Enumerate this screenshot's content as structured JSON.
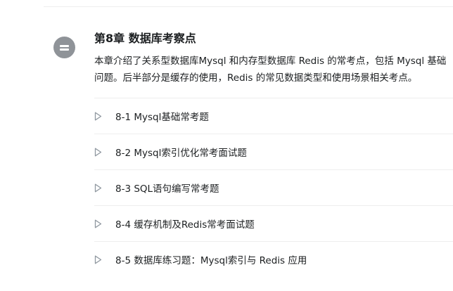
{
  "chapter": {
    "icon": "list-icon",
    "title": "第8章 数据库考察点",
    "description_lines": [
      "本章介绍了关系型数据库Mysql 和内存型数据库 Redis 的常考点，包括 Mysql 基础",
      "问题。后半部分是缓存的使用，Redis 的常见数据类型和使用场景相关考点。"
    ]
  },
  "lessons": [
    {
      "label": "8-1 Mysql基础常考题",
      "icon": "play-triangle-icon"
    },
    {
      "label": "8-2 Mysql索引优化常考面试题",
      "icon": "play-triangle-icon"
    },
    {
      "label": "8-3 SQL语句编写常考题",
      "icon": "play-triangle-icon"
    },
    {
      "label": "8-4 缓存机制及Redis常考面试题",
      "icon": "play-triangle-icon"
    },
    {
      "label": "8-5 数据库练习题：Mysql索引与 Redis 应用",
      "icon": "play-triangle-icon"
    }
  ],
  "colors": {
    "text": "#1c1f21",
    "icon_bg": "#8f9398",
    "play_icon": "#9199a1",
    "divider": "#eeeeee"
  }
}
